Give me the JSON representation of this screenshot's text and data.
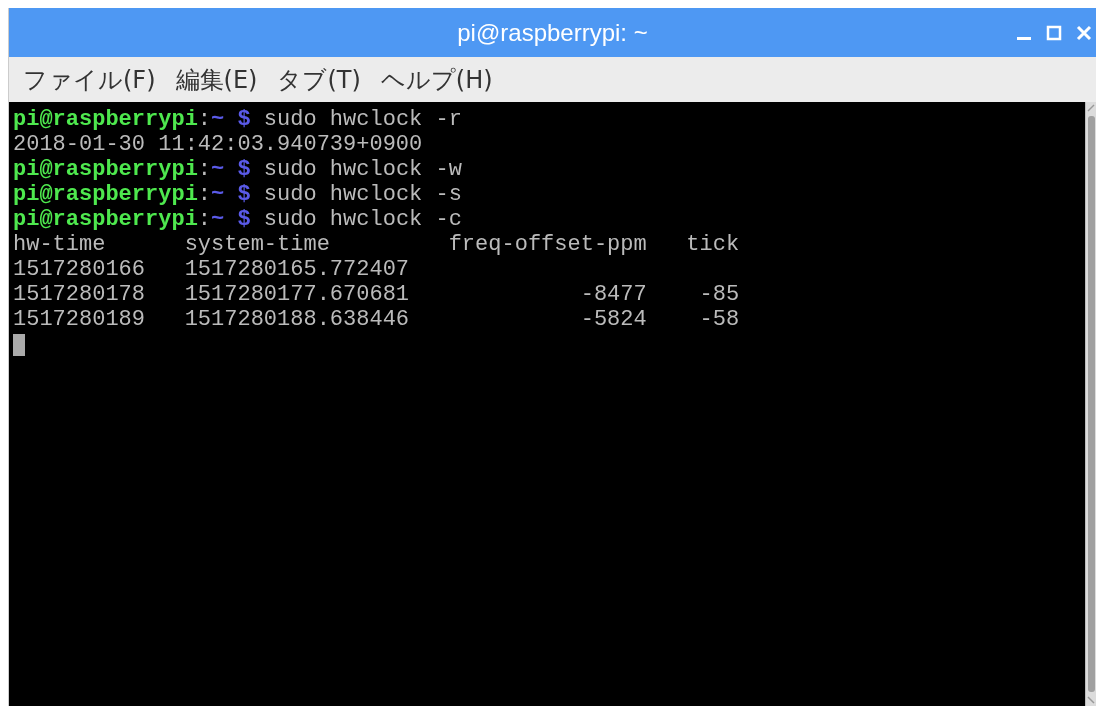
{
  "window": {
    "title": "pi@raspberrypi: ~"
  },
  "menu": [
    {
      "label": "ファイル(F)"
    },
    {
      "label": "編集(E)"
    },
    {
      "label": "タブ(T)"
    },
    {
      "label": "ヘルプ(H)"
    }
  ],
  "terminal": {
    "lines": [
      {
        "kind": "prompt",
        "user_host": "pi@raspberrypi",
        "separator": ":",
        "path": "~",
        "symbol": "$",
        "command": "sudo hwclock -r"
      },
      {
        "kind": "output",
        "text": "2018-01-30 11:42:03.940739+0900"
      },
      {
        "kind": "prompt",
        "user_host": "pi@raspberrypi",
        "separator": ":",
        "path": "~",
        "symbol": "$",
        "command": "sudo hwclock -w"
      },
      {
        "kind": "prompt",
        "user_host": "pi@raspberrypi",
        "separator": ":",
        "path": "~",
        "symbol": "$",
        "command": "sudo hwclock -s"
      },
      {
        "kind": "prompt",
        "user_host": "pi@raspberrypi",
        "separator": ":",
        "path": "~",
        "symbol": "$",
        "command": "sudo hwclock -c"
      },
      {
        "kind": "output",
        "text": "hw-time      system-time         freq-offset-ppm   tick"
      },
      {
        "kind": "output",
        "text": "1517280166   1517280165.772407"
      },
      {
        "kind": "output",
        "text": "1517280178   1517280177.670681             -8477    -85"
      },
      {
        "kind": "output",
        "text": "1517280189   1517280188.638446             -5824    -58"
      }
    ]
  }
}
